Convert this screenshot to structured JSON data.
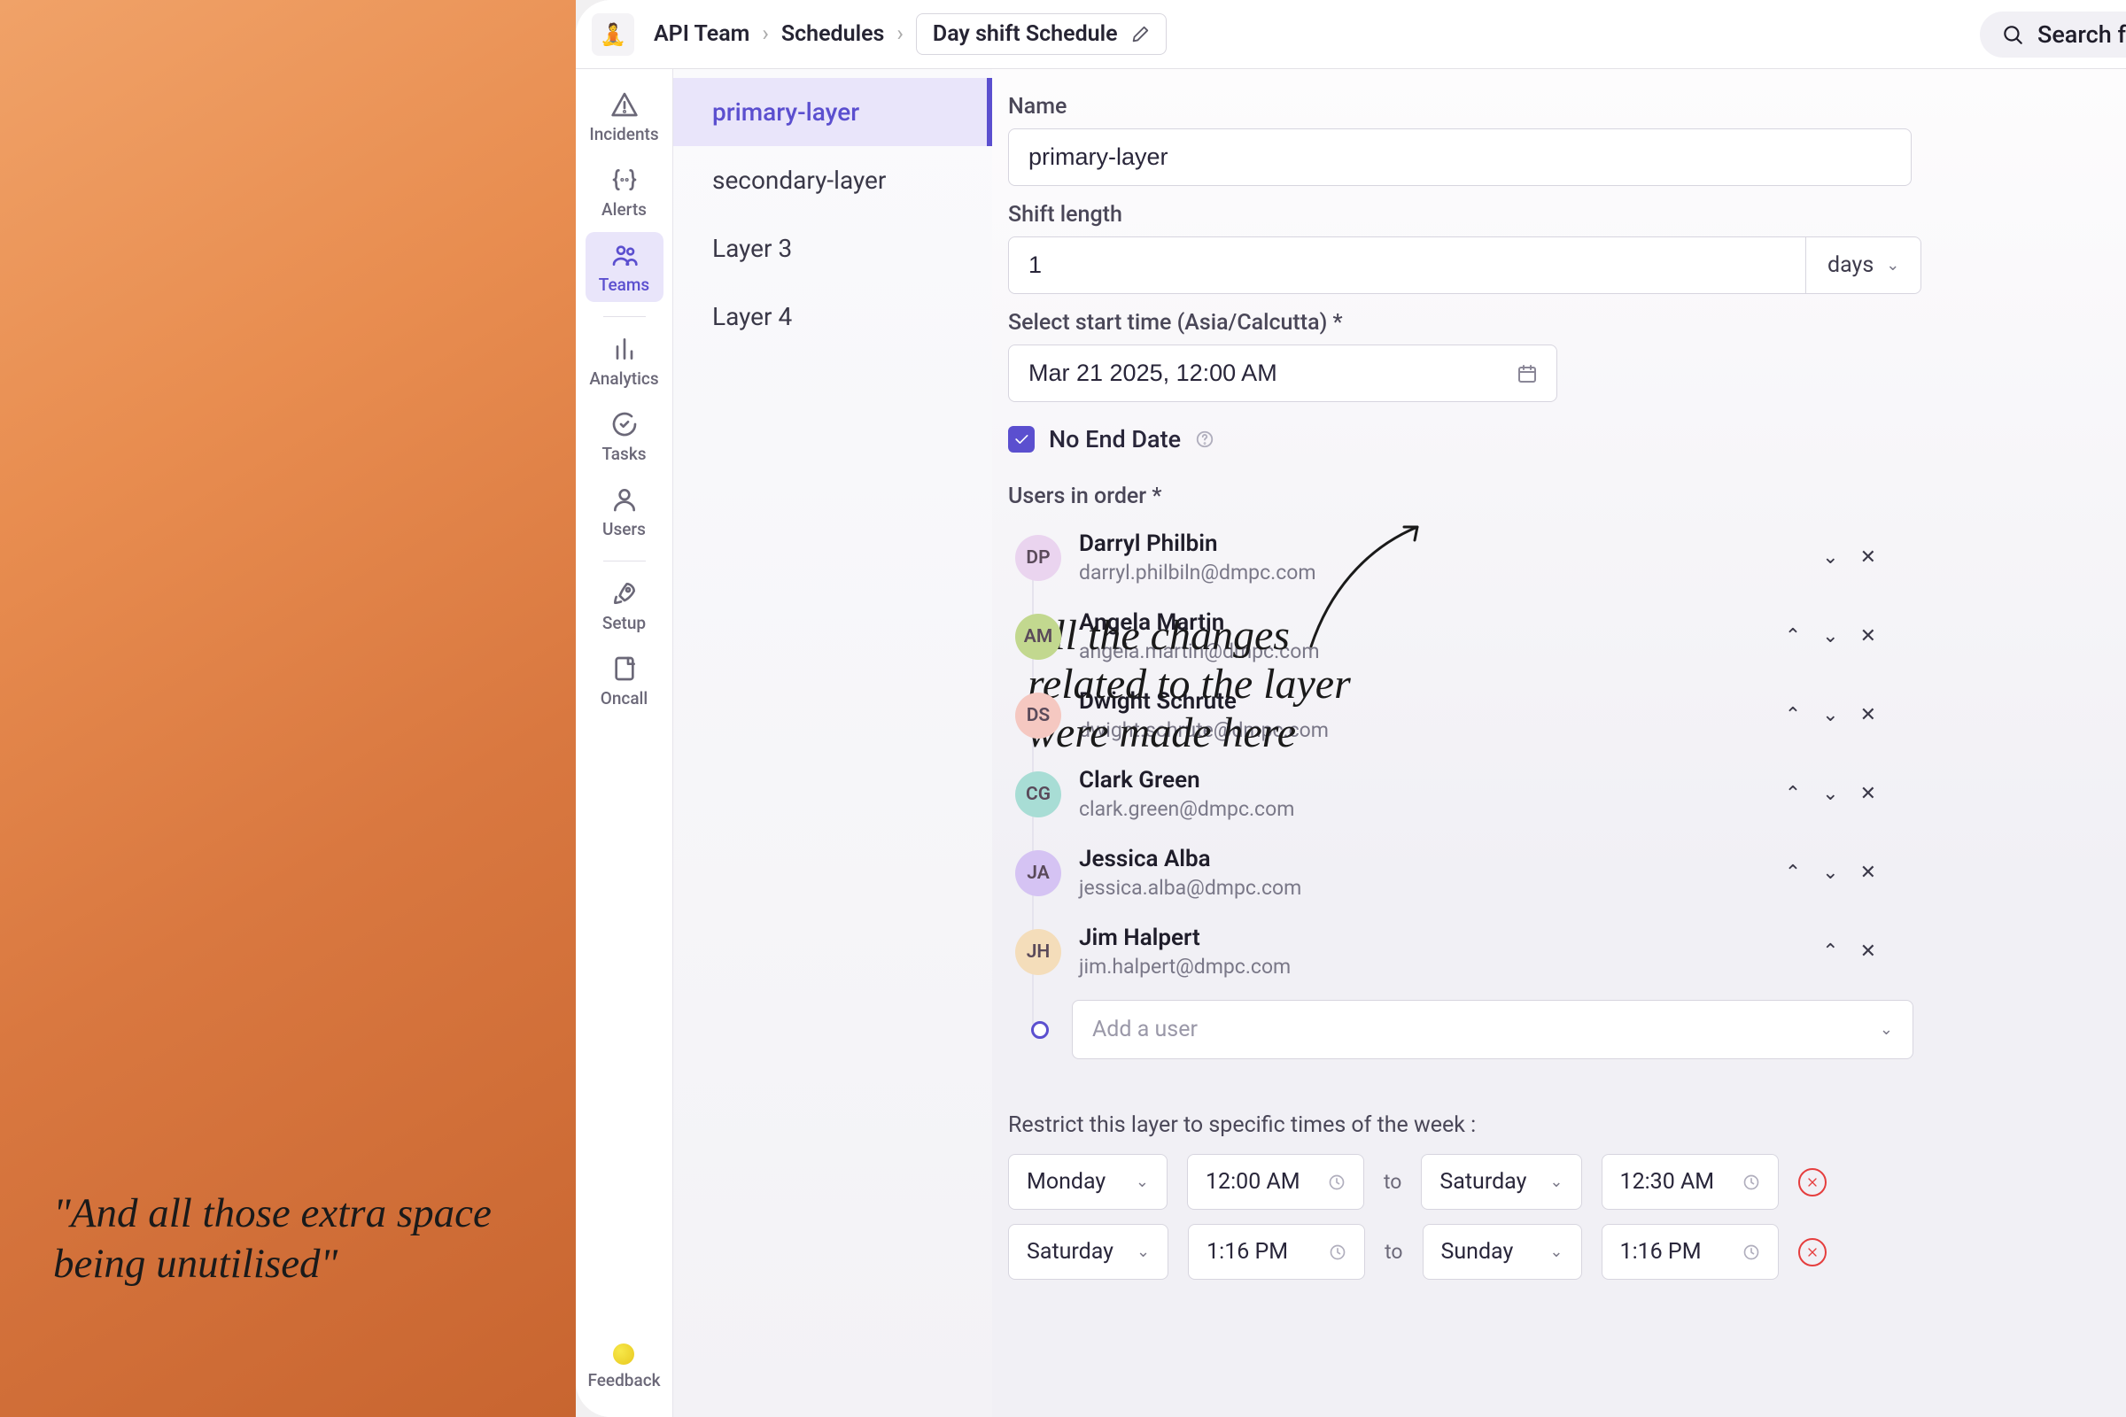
{
  "annotation": {
    "quote_left": "\"And all those extra space being unutilised\"",
    "mid_note_l1": "All the changes",
    "mid_note_l2": "related to the layer",
    "mid_note_l3": "were made here"
  },
  "header": {
    "crumb_team": "API Team",
    "crumb_schedules": "Schedules",
    "crumb_schedule_name": "Day shift Schedule",
    "search_placeholder": "Search f"
  },
  "vnav": {
    "incidents": "Incidents",
    "alerts": "Alerts",
    "teams": "Teams",
    "analytics": "Analytics",
    "tasks": "Tasks",
    "users": "Users",
    "setup": "Setup",
    "oncall": "Oncall",
    "feedback": "Feedback"
  },
  "layers": {
    "l0": "primary-layer",
    "l1": "secondary-layer",
    "l2": "Layer 3",
    "l3": "Layer 4"
  },
  "form": {
    "name_label": "Name",
    "name_value": "primary-layer",
    "shift_len_label": "Shift length",
    "shift_len_value": "1",
    "shift_unit": "days",
    "start_label": "Select start time (Asia/Calcutta) *",
    "start_value": "Mar 21 2025, 12:00 AM",
    "no_end_label": "No End Date",
    "users_label": "Users in order *",
    "add_user_placeholder": "Add a user",
    "restrict_label": "Restrict this layer to specific times of the week :",
    "to_word": "to"
  },
  "users": [
    {
      "initials": "DP",
      "name": "Darryl Philbin",
      "email": "darryl.philbiln@dmpc.com",
      "cls": "av-dp",
      "first": true,
      "last": false
    },
    {
      "initials": "AM",
      "name": "Angela Martin",
      "email": "angela.martin@dmpc.com",
      "cls": "av-am",
      "first": false,
      "last": false
    },
    {
      "initials": "DS",
      "name": "Dwight Schrute",
      "email": "dwight.schrute@dmpc.com",
      "cls": "av-ds",
      "first": false,
      "last": false
    },
    {
      "initials": "CG",
      "name": "Clark Green",
      "email": "clark.green@dmpc.com",
      "cls": "av-cg",
      "first": false,
      "last": false
    },
    {
      "initials": "JA",
      "name": "Jessica Alba",
      "email": "jessica.alba@dmpc.com",
      "cls": "av-ja",
      "first": false,
      "last": false
    },
    {
      "initials": "JH",
      "name": "Jim Halpert",
      "email": "jim.halpert@dmpc.com",
      "cls": "av-jh",
      "first": false,
      "last": true
    }
  ],
  "restrict": [
    {
      "day_from": "Monday",
      "time_from": "12:00 AM",
      "day_to": "Saturday",
      "time_to": "12:30 AM"
    },
    {
      "day_from": "Saturday",
      "time_from": "1:16 PM",
      "day_to": "Sunday",
      "time_to": "1:16 PM"
    }
  ],
  "colors": {
    "accent": "#5b4fcf",
    "danger": "#e53e3e"
  }
}
